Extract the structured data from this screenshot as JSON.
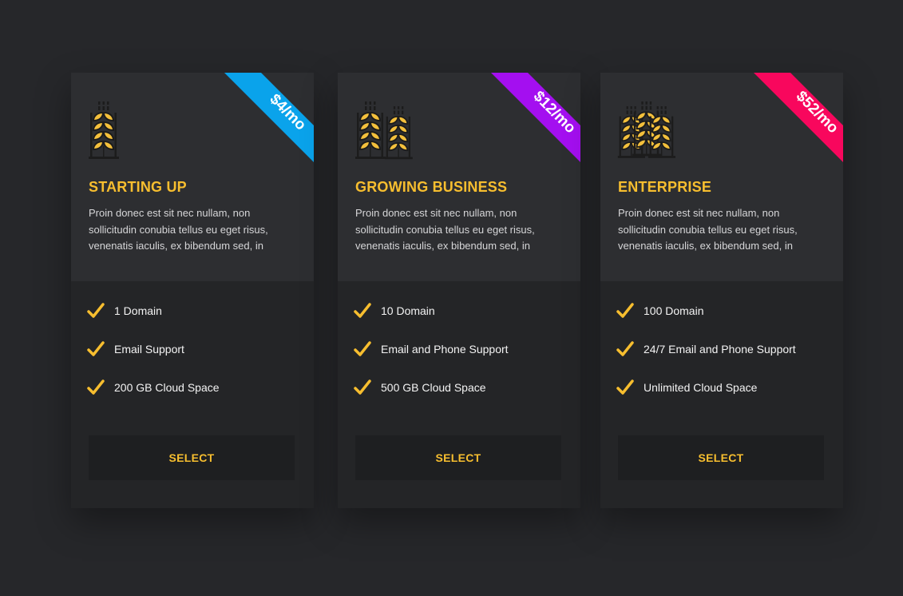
{
  "plans": [
    {
      "ribbon": "$4/mo",
      "ribbon_color": "#0aa3eb",
      "title": "STARTING UP",
      "icon": "wheat-icon",
      "description": "Proin donec est sit nec nullam, non sollicitudin conubia tellus eu eget risus, venenatis iaculis, ex bibendum sed, in",
      "features": [
        "1 Domain",
        "Email Support",
        "200 GB Cloud Space"
      ],
      "button": "SELECT"
    },
    {
      "ribbon": "$12/mo",
      "ribbon_color": "#a40ff0",
      "title": "GROWING BUSINESS",
      "icon": "wheat-double-icon",
      "description": "Proin donec est sit nec nullam, non sollicitudin conubia tellus eu eget risus, venenatis iaculis, ex bibendum sed, in",
      "features": [
        "10 Domain",
        "Email and Phone Support",
        "500 GB Cloud Space"
      ],
      "button": "SELECT"
    },
    {
      "ribbon": "$52/mo",
      "ribbon_color": "#f8075d",
      "title": "ENTERPRISE",
      "icon": "wheat-triple-icon",
      "description": "Proin donec est sit nec nullam, non sollicitudin conubia tellus eu eget risus, venenatis iaculis, ex bibendum sed, in",
      "features": [
        "100 Domain",
        "24/7 Email and Phone Support",
        "Unlimited Cloud Space"
      ],
      "button": "SELECT"
    }
  ],
  "colors": {
    "accent": "#f7be2f",
    "background": "#26272a"
  }
}
